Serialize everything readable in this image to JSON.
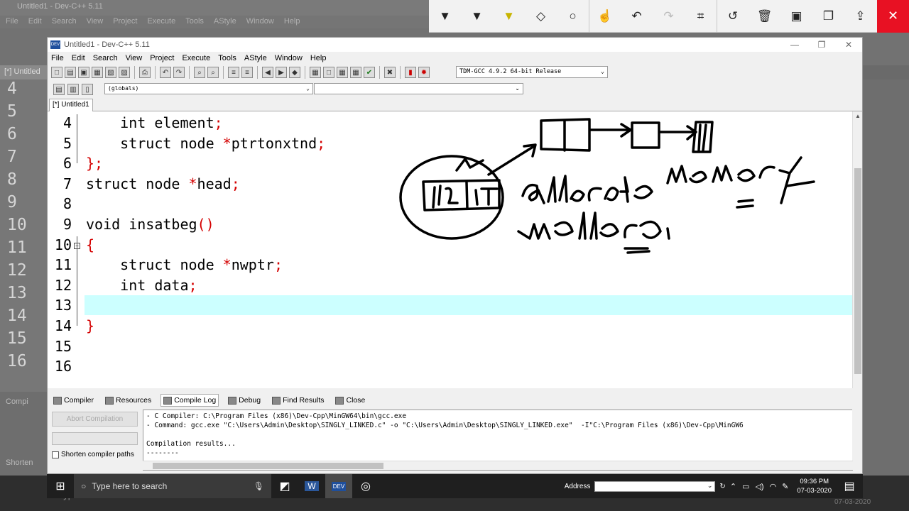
{
  "background": {
    "title": "Untitled1 - Dev-C++ 5.11",
    "menu": [
      "File",
      "Edit",
      "Search",
      "View",
      "Project",
      "Execute",
      "Tools",
      "AStyle",
      "Window",
      "Help"
    ],
    "tab": "[*] Untitled",
    "gutter": [
      "4",
      "5",
      "6",
      "7",
      "8",
      "9",
      "10",
      "11",
      "12",
      "13",
      "14",
      "15",
      "16"
    ],
    "bottom_labels": [
      "Compi",
      "Shorten"
    ],
    "taskbar_search": "Type here to search",
    "taskbar_address": "Address",
    "taskbar_date": "07-03-2020"
  },
  "annotation_toolbar": {
    "icons": [
      "pen-icon",
      "pen-icon",
      "highlighter-icon",
      "eraser-icon",
      "shape-icon",
      "touch-icon",
      "undo-icon",
      "redo-icon",
      "crop-icon",
      "history-icon",
      "delete-icon",
      "save-icon",
      "copy-icon",
      "share-icon"
    ],
    "close": "✕"
  },
  "window": {
    "title": "Untitled1 - Dev-C++ 5.11",
    "logo": "DEV",
    "menu": [
      "File",
      "Edit",
      "Search",
      "View",
      "Project",
      "Execute",
      "Tools",
      "AStyle",
      "Window",
      "Help"
    ],
    "compiler": "TDM-GCC 4.9.2 64-bit Release",
    "globals": "(globals)",
    "tab": "[*] Untitled1"
  },
  "editor": {
    "lines": [
      {
        "n": "4",
        "indent": "    ",
        "parts": [
          [
            "int element",
            ""
          ],
          [
            ";",
            "red"
          ]
        ]
      },
      {
        "n": "5",
        "indent": "    ",
        "parts": [
          [
            "struct node ",
            ""
          ],
          [
            "*",
            "red"
          ],
          [
            "ptrtonxtnd",
            ""
          ],
          [
            ";",
            "red"
          ]
        ]
      },
      {
        "n": "6",
        "indent": "",
        "parts": [
          [
            "};",
            "red"
          ]
        ]
      },
      {
        "n": "7",
        "indent": "",
        "parts": [
          [
            "struct node ",
            ""
          ],
          [
            "*",
            "red"
          ],
          [
            "head",
            ""
          ],
          [
            ";",
            "red"
          ]
        ]
      },
      {
        "n": "8",
        "indent": "",
        "parts": []
      },
      {
        "n": "9",
        "indent": "",
        "parts": [
          [
            "void insatbeg",
            ""
          ],
          [
            "()",
            "red"
          ]
        ]
      },
      {
        "n": "10",
        "indent": "",
        "parts": [
          [
            "{",
            "red"
          ]
        ]
      },
      {
        "n": "11",
        "indent": "    ",
        "parts": [
          [
            "struct node ",
            ""
          ],
          [
            "*",
            "red"
          ],
          [
            "nwptr",
            ""
          ],
          [
            ";",
            "red"
          ]
        ]
      },
      {
        "n": "12",
        "indent": "    ",
        "parts": [
          [
            "int data",
            ""
          ],
          [
            ";",
            "red"
          ]
        ]
      },
      {
        "n": "13",
        "indent": "",
        "parts": []
      },
      {
        "n": "14",
        "indent": "",
        "parts": [
          [
            "}",
            "red"
          ]
        ]
      },
      {
        "n": "15",
        "indent": "",
        "parts": []
      },
      {
        "n": "16",
        "indent": "",
        "parts": []
      }
    ],
    "highlighted_line": "13"
  },
  "bottom_panel": {
    "tabs": [
      "Compiler",
      "Resources",
      "Compile Log",
      "Debug",
      "Find Results",
      "Close"
    ],
    "active_tab": "Compile Log",
    "abort_button": "Abort Compilation",
    "shorten_label": "Shorten compiler paths",
    "log": [
      "- C Compiler: C:\\Program Files (x86)\\Dev-Cpp\\MinGW64\\bin\\gcc.exe",
      "- Command: gcc.exe \"C:\\Users\\Admin\\Desktop\\SINGLY_LINKED.c\" -o \"C:\\Users\\Admin\\Desktop\\SINGLY_LINKED.exe\"  -I\"C:\\Program Files (x86)\\Dev-Cpp\\MinGW6",
      "",
      "Compilation results...",
      "--------"
    ]
  },
  "taskbar": {
    "search_placeholder": "Type here to search",
    "address_label": "Address",
    "time": "09:36 PM",
    "date": "07-03-2020"
  },
  "colors": {
    "keyword_red": "#d40000",
    "current_line": "#ccffff",
    "close_red": "#e81123",
    "dev_logo_blue": "#1f4f9c"
  }
}
